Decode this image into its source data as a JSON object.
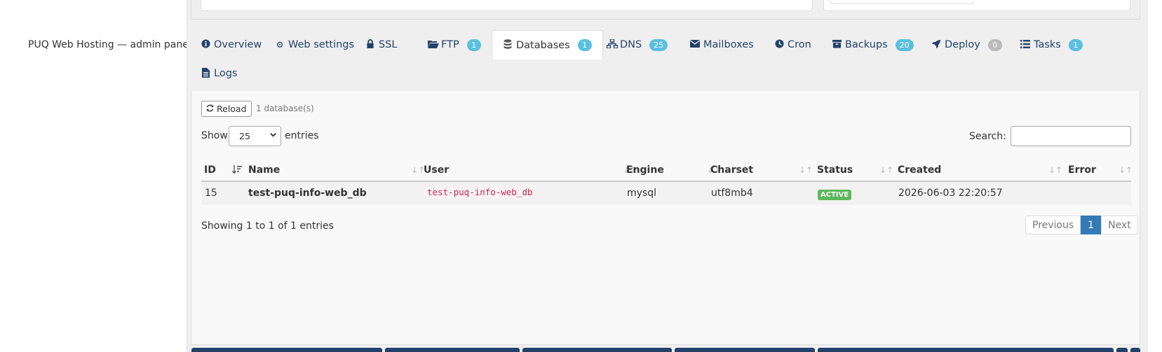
{
  "app": {
    "title": "PUQ Web Hosting — admin panel"
  },
  "tabs": [
    {
      "label": "Overview",
      "icon": "info-circle-icon"
    },
    {
      "label": "Web settings",
      "icon": "gear-icon"
    },
    {
      "label": "SSL",
      "icon": "lock-icon"
    },
    {
      "label": "FTP",
      "icon": "folder-open-icon",
      "badge": "1"
    },
    {
      "label": "Databases",
      "icon": "database-icon",
      "badge": "1",
      "active": true
    },
    {
      "label": "DNS",
      "icon": "sitemap-icon",
      "badge": "25"
    },
    {
      "label": "Mailboxes",
      "icon": "envelope-icon"
    },
    {
      "label": "Cron",
      "icon": "clock-icon"
    },
    {
      "label": "Backups",
      "icon": "archive-icon",
      "badge": "20"
    },
    {
      "label": "Deploy",
      "icon": "rocket-icon",
      "badge": "0"
    },
    {
      "label": "Tasks",
      "icon": "list-icon",
      "badge": "1"
    },
    {
      "label": "Logs",
      "icon": "file-icon"
    }
  ],
  "toolbar": {
    "reload_label": "Reload",
    "count": "1 database(s)"
  },
  "length": {
    "show": "Show",
    "value": "25",
    "entries": "entries"
  },
  "search": {
    "label": "Search:",
    "value": ""
  },
  "table": {
    "columns": [
      "ID",
      "Name",
      "User",
      "Engine",
      "Charset",
      "Status",
      "Created",
      "Error"
    ],
    "rows": [
      {
        "id": "15",
        "name": "test-puq-info-web_db",
        "user": "test-puq-info-web_db",
        "engine": "mysql",
        "charset": "utf8mb4",
        "status": "ACTIVE",
        "created": "2026-06-03 22:20:57",
        "error": ""
      }
    ]
  },
  "footer": {
    "info": "Showing 1 to 1 of 1 entries",
    "prev": "Previous",
    "page": "1",
    "next": "Next"
  },
  "colors": {
    "link": "#23426b",
    "badge": "#5bc0de",
    "active_status": "#5cb85c",
    "page_active": "#337ab7"
  }
}
